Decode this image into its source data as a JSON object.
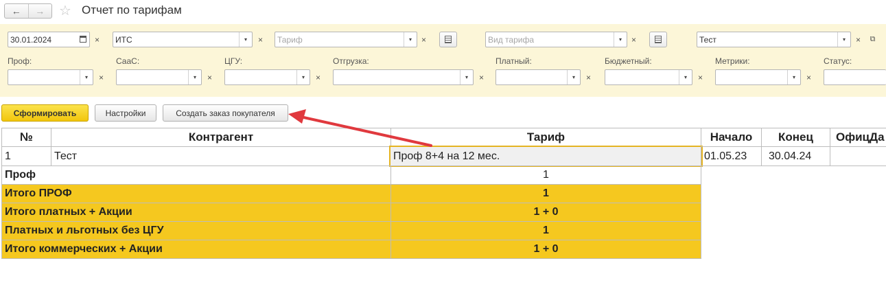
{
  "window": {
    "title": "Отчет по тарифам",
    "back_icon": "←",
    "forward_icon": "→",
    "star_icon": "☆"
  },
  "filters": {
    "date": "30.01.2024",
    "product": "ИТС",
    "tariff_placeholder": "Тариф",
    "tariff_type_placeholder": "Вид тарифа",
    "counterparty": "Тест",
    "labels": {
      "prof": "Проф:",
      "saas": "СааС:",
      "cgu": "ЦГУ:",
      "shipment": "Отгрузка:",
      "paid": "Платный:",
      "budget": "Бюджетный:",
      "metrics": "Метрики:",
      "status": "Статус:"
    }
  },
  "toolbar": {
    "generate": "Сформировать",
    "settings": "Настройки",
    "create_order": "Создать заказ покупателя"
  },
  "table": {
    "headers": {
      "num": "№",
      "counterparty": "Контрагент",
      "tariff": "Тариф",
      "start": "Начало",
      "end": "Конец",
      "official": "ОфицДа"
    },
    "row": {
      "num": "1",
      "counterparty": "Тест",
      "tariff": "Проф 8+4 на 12 мес.",
      "start": "01.05.23",
      "end": "30.04.24"
    },
    "prof_row": {
      "label": "Проф",
      "value": "1"
    },
    "totals": [
      {
        "label": "Итого ПРОФ",
        "value": "1"
      },
      {
        "label": "Итого платных + Акции",
        "value": "1 + 0"
      },
      {
        "label": "Платных и льготных без ЦГУ",
        "value": "1"
      },
      {
        "label": "Итого коммерческих + Акции",
        "value": "1 + 0"
      }
    ]
  },
  "colors": {
    "panel": "#fcf6d8",
    "total_fill": "#f5c81f",
    "arrow": "#e0393e",
    "highlight_border": "#e5b422"
  }
}
